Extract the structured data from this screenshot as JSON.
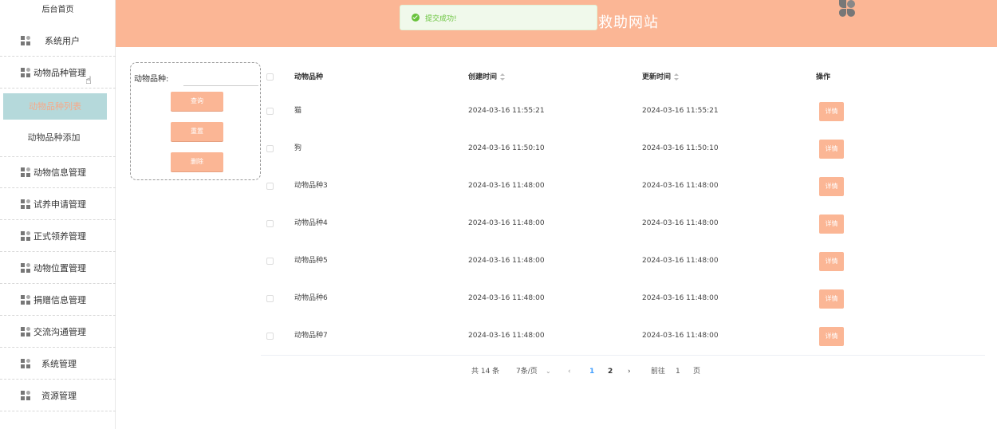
{
  "sidebar": {
    "home": "后台首页",
    "items": [
      {
        "label": "系统用户"
      },
      {
        "label": "动物品种管理"
      },
      {
        "label": "动物信息管理"
      },
      {
        "label": "试养申请管理"
      },
      {
        "label": "正式领养管理"
      },
      {
        "label": "动物位置管理"
      },
      {
        "label": "捐赠信息管理"
      },
      {
        "label": "交流沟通管理"
      },
      {
        "label": "系统管理"
      },
      {
        "label": "资源管理"
      }
    ],
    "sub_items": {
      "active": "动物品种列表",
      "add": "动物品种添加"
    }
  },
  "header": {
    "title": "救助网站",
    "avatar_icon": "user-avatar-icon",
    "bg_color": "#fbb695"
  },
  "toast": {
    "message": "提交成功!"
  },
  "search": {
    "label": "动物品种:",
    "placeholder": "",
    "query": "查询",
    "reset": "重置",
    "delete": "删除"
  },
  "table": {
    "headers": {
      "name": "动物品种",
      "created": "创建时间",
      "updated": "更新时间",
      "actions": "操作"
    },
    "rows": [
      {
        "name": "猫",
        "created": "2024-03-16 11:55:21",
        "updated": "2024-03-16 11:55:21",
        "action": "详情"
      },
      {
        "name": "狗",
        "created": "2024-03-16 11:50:10",
        "updated": "2024-03-16 11:50:10",
        "action": "详情"
      },
      {
        "name": "动物品种3",
        "created": "2024-03-16 11:48:00",
        "updated": "2024-03-16 11:48:00",
        "action": "详情"
      },
      {
        "name": "动物品种4",
        "created": "2024-03-16 11:48:00",
        "updated": "2024-03-16 11:48:00",
        "action": "详情"
      },
      {
        "name": "动物品种5",
        "created": "2024-03-16 11:48:00",
        "updated": "2024-03-16 11:48:00",
        "action": "详情"
      },
      {
        "name": "动物品种6",
        "created": "2024-03-16 11:48:00",
        "updated": "2024-03-16 11:48:00",
        "action": "详情"
      },
      {
        "name": "动物品种7",
        "created": "2024-03-16 11:48:00",
        "updated": "2024-03-16 11:48:00",
        "action": "详情"
      }
    ]
  },
  "pagination": {
    "total": "共 14 条",
    "page_size": "7条/页",
    "pages": [
      "1",
      "2"
    ],
    "goto_label": "前往",
    "goto_value": "1",
    "goto_suffix": "页"
  }
}
